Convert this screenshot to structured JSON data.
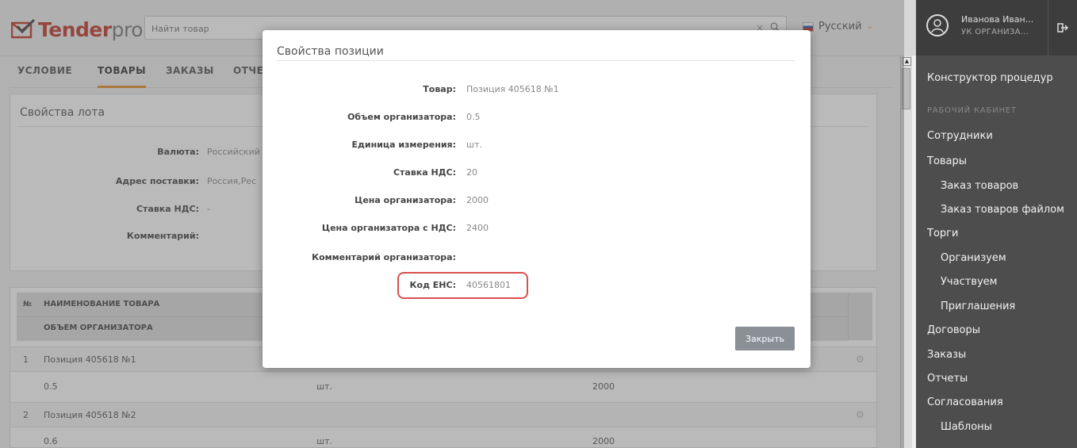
{
  "header": {
    "logo_bold": "Tender",
    "logo_light": "pro",
    "search_placeholder": "Найти товар",
    "language": "Русский"
  },
  "tabs": [
    {
      "label": "УСЛОВИЕ"
    },
    {
      "label": "ТОВАРЫ"
    },
    {
      "label": "ЗАКАЗЫ"
    },
    {
      "label": "ОТЧЕ"
    }
  ],
  "lot": {
    "title": "Свойства лота",
    "fields": [
      {
        "label": "Валюта:",
        "value": "Российский"
      },
      {
        "label": "Адрес поставки:",
        "value": "Россия,Рес"
      },
      {
        "label": "Ставка НДС:",
        "value": "-"
      },
      {
        "label": "Комментарий:",
        "value": ""
      }
    ]
  },
  "table": {
    "col_num": "№",
    "col_name": "НАИМЕНОВАНИЕ ТОВАРА",
    "col_volume": "ОБЪЕМ ОРГАНИЗАТОРА",
    "rows": [
      {
        "num": "1",
        "name": "Позиция 405618 №1",
        "volume": "0.5",
        "unit": "шт.",
        "price": "2000"
      },
      {
        "num": "2",
        "name": "Позиция 405618 №2",
        "volume": "0.6",
        "unit": "шт.",
        "price": "2000"
      }
    ]
  },
  "modal": {
    "title": "Свойства позиции",
    "fields": [
      {
        "label": "Товар:",
        "value": "Позиция 405618 №1"
      },
      {
        "label": "Объем организатора:",
        "value": "0.5"
      },
      {
        "label": "Единица измерения:",
        "value": "шт."
      },
      {
        "label": "Ставка НДС:",
        "value": "20"
      },
      {
        "label": "Цена организатора:",
        "value": "2000"
      },
      {
        "label": "Цена организатора с НДС:",
        "value": "2400"
      },
      {
        "label": "Комментарий организатора:",
        "value": ""
      },
      {
        "label": "Код ЕНС:",
        "value": "40561801"
      }
    ],
    "close_label": "Закрыть"
  },
  "user": {
    "name": "Иванова Иван...",
    "org": "УК ОРГАНИЗА..."
  },
  "sidebar": {
    "items": [
      {
        "label": "Конструктор процедур"
      },
      {
        "label": "РАБОЧИЙ КАБИНЕТ"
      },
      {
        "label": "Сотрудники"
      },
      {
        "label": "Товары"
      },
      {
        "label": "Заказ товаров"
      },
      {
        "label": "Заказ товаров файлом"
      },
      {
        "label": "Торги"
      },
      {
        "label": "Организуем"
      },
      {
        "label": "Участвуем"
      },
      {
        "label": "Приглашения"
      },
      {
        "label": "Договоры"
      },
      {
        "label": "Заказы"
      },
      {
        "label": "Отчеты"
      },
      {
        "label": "Согласования"
      },
      {
        "label": "Шаблоны"
      }
    ]
  },
  "colors": {
    "accent": "#e88c2a",
    "brand": "#c0392b",
    "highlight": "#d94f4f",
    "sidebar_bg": "#4d4d4d"
  }
}
